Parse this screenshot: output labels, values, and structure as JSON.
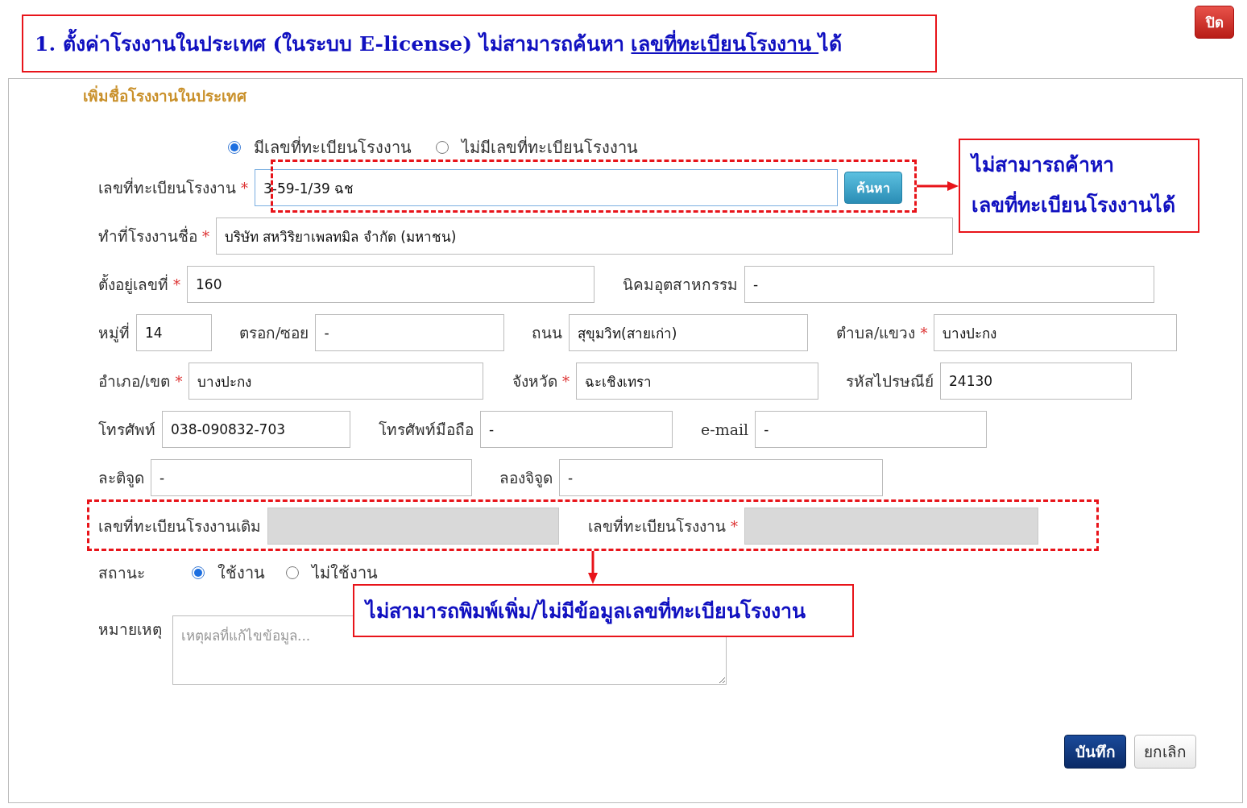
{
  "annotation_title": {
    "prefix": "1. ตั้งค่าโรงงานในประเทศ (ในระบบ E-license) ไม่สามารถค้นหา ",
    "underlined": "เลขที่ทะเบียนโรงงาน ",
    "suffix": "ได้"
  },
  "close_button": "ปิด",
  "form": {
    "heading": "เพิ่มชื่อโรงงานในประเทศ",
    "registration_options": [
      {
        "label": "มีเลขที่ทะเบียนโรงงาน",
        "selected": true
      },
      {
        "label": "ไม่มีเลขที่ทะเบียนโรงงาน",
        "selected": false
      }
    ],
    "rows": [
      {
        "fields": [
          {
            "label": "เลขที่ทะเบียนโรงงาน",
            "required_mark": "*",
            "value": "3-59-1/39 ฉช",
            "disabled": false,
            "button": "ค้นหา"
          }
        ]
      },
      {
        "fields": [
          {
            "label": "ทำที่โรงงานชื่อ",
            "required_mark": "*",
            "value": "บริษัท สหวิริยาเพลทมิล จำกัด (มหาชน)",
            "disabled": false
          }
        ]
      },
      {
        "fields": [
          {
            "label": "ตั้งอยู่เลขที่",
            "required_mark": "*",
            "value": "160",
            "disabled": false
          },
          {
            "label": "นิคมอุตสาหกรรม",
            "value": "-",
            "disabled": false
          }
        ]
      },
      {
        "fields": [
          {
            "label": "หมู่ที่",
            "value": "14",
            "disabled": false
          },
          {
            "label": "ตรอก/ซอย",
            "value": "-",
            "disabled": false
          },
          {
            "label": "ถนน",
            "value": "สุขุมวิท(สายเก่า)",
            "disabled": false
          },
          {
            "label": "ตำบล/แขวง",
            "required_mark": "*",
            "value": "บางปะกง",
            "disabled": false
          }
        ]
      },
      {
        "fields": [
          {
            "label": "อำเภอ/เขต",
            "required_mark": "*",
            "value": "บางปะกง",
            "disabled": false
          },
          {
            "label": "จังหวัด",
            "required_mark": "*",
            "value": "ฉะเชิงเทรา",
            "disabled": false
          },
          {
            "label": "รหัสไปรษณีย์",
            "value": "24130",
            "disabled": false
          }
        ]
      },
      {
        "fields": [
          {
            "label": "โทรศัพท์",
            "value": "038-090832-703",
            "disabled": false
          },
          {
            "label": "โทรศัพท์มือถือ",
            "value": "-",
            "disabled": false
          },
          {
            "label": "e-mail",
            "value": "-",
            "disabled": false
          }
        ]
      },
      {
        "fields": [
          {
            "label": "ละติจูด",
            "value": "-",
            "disabled": false
          },
          {
            "label": "ลองจิจูด",
            "value": "-",
            "disabled": false
          }
        ]
      },
      {
        "fields": [
          {
            "label": "เลขที่ทะเบียนโรงงานเดิม",
            "disabled": true
          },
          {
            "label": "เลขที่ทะเบียนโรงงาน",
            "required_mark": "*",
            "disabled": true
          }
        ]
      }
    ],
    "status": {
      "label": "สถานะ",
      "options": [
        {
          "label": "ใช้งาน",
          "selected": true
        },
        {
          "label": "ไม่ใช้งาน",
          "selected": false
        }
      ]
    },
    "remark": {
      "label": "หมายเหตุ",
      "placeholder": "เหตุผลที่แก้ไขข้อมูล..."
    },
    "buttons": [
      {
        "label": "บันทึก",
        "kind": "primary"
      },
      {
        "label": "ยกเลิก",
        "kind": "secondary"
      }
    ]
  },
  "search_note": {
    "lines": [
      "ไม่สามารถค้าหา",
      "เลขที่ทะเบียนโรงงานได้"
    ]
  },
  "disabled_note": "ไม่สามารถพิมพ์เพิ่ม/ไม่มีข้อมูลเลขที่ทะเบียนโรงงาน"
}
